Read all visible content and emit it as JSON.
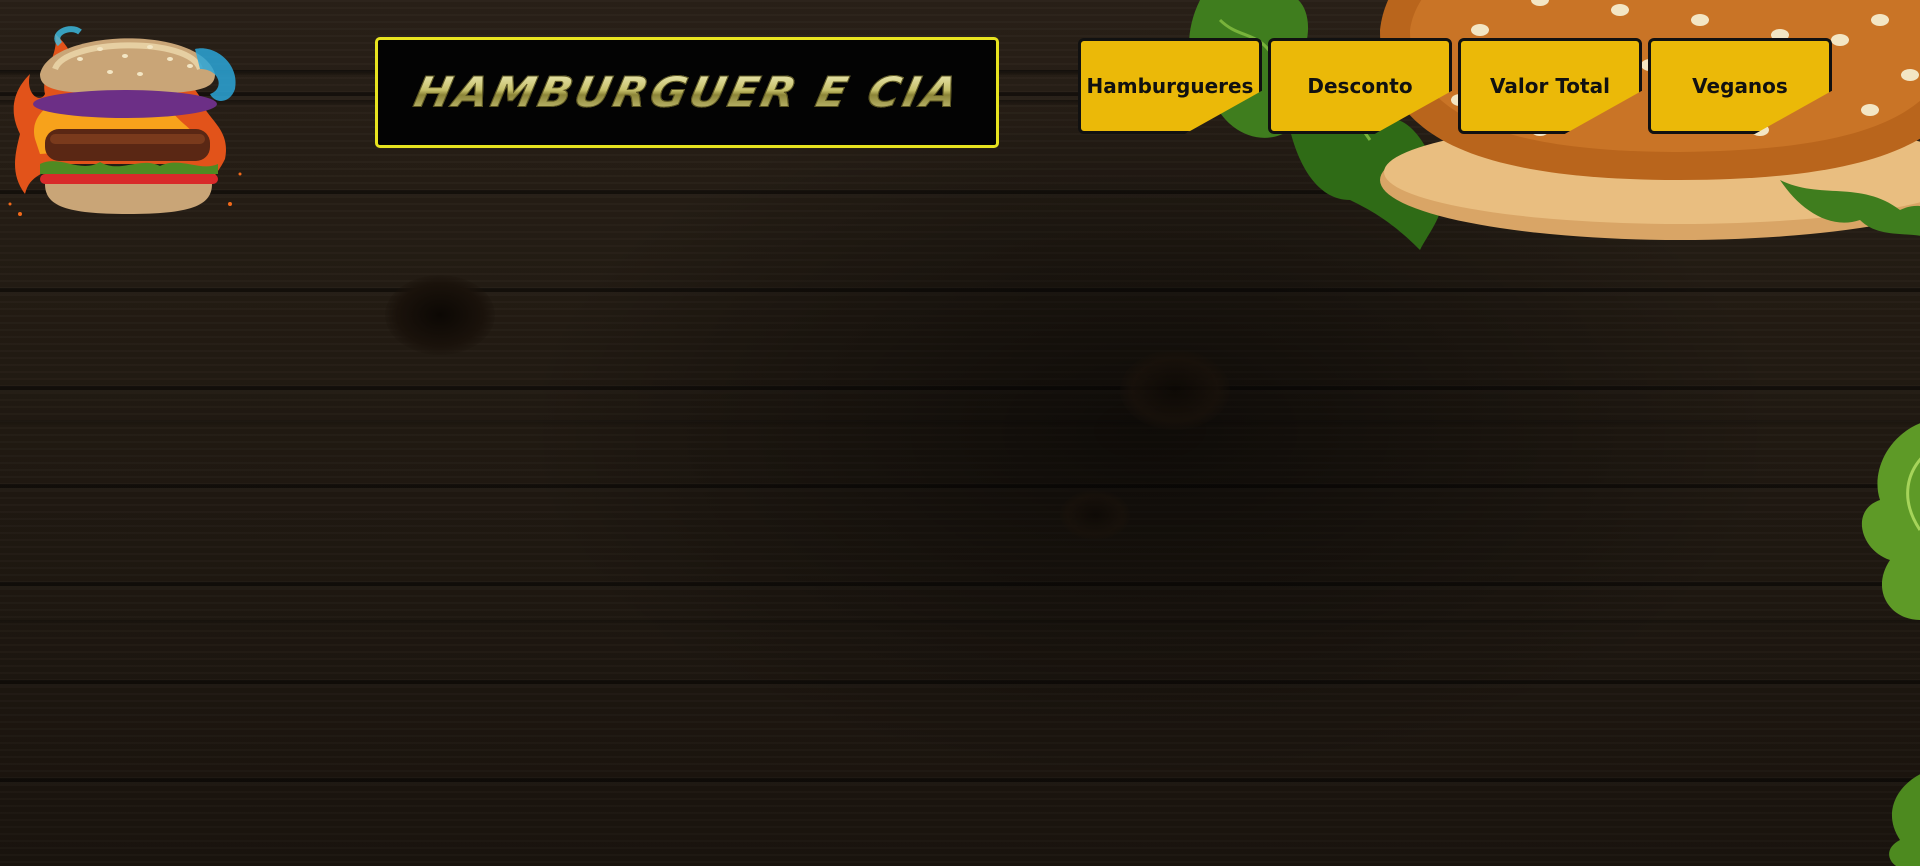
{
  "brand": {
    "title": "HAMBURGUER E CIA",
    "logo_icon": "flaming-burger-icon"
  },
  "nav": {
    "items": [
      {
        "label": "Hamburgueres"
      },
      {
        "label": "Desconto"
      },
      {
        "label": "Valor Total"
      },
      {
        "label": "Veganos"
      }
    ]
  },
  "theme": {
    "nav_button_color": "#ebb908",
    "title_border_color": "#e7e31f",
    "background": "#231b13"
  }
}
